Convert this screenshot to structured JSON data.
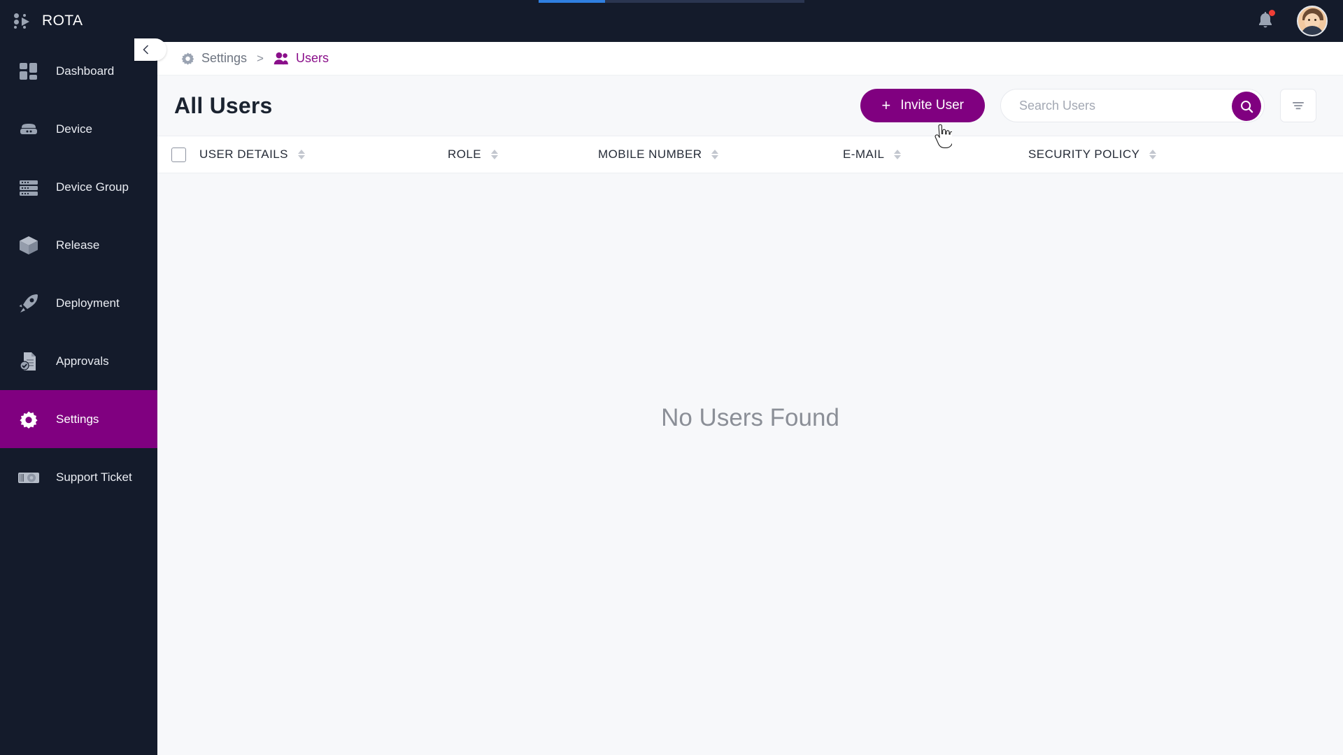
{
  "app": {
    "brand_name": "ROTA",
    "logo_icon": "rota-dots-logo"
  },
  "topbar": {
    "notification_icon": "bell-icon",
    "notification_badge": "",
    "avatar_icon": "user-avatar",
    "progress_icon": "loading-progress-bar"
  },
  "sidebar": {
    "collapse_icon": "chevron-left-icon",
    "items": [
      {
        "label": "Dashboard",
        "icon": "dashboard-grid-icon",
        "active": false
      },
      {
        "label": "Device",
        "icon": "device-server-icon",
        "active": false
      },
      {
        "label": "Device Group",
        "icon": "device-group-icon",
        "active": false
      },
      {
        "label": "Release",
        "icon": "release-box-icon",
        "active": false
      },
      {
        "label": "Deployment",
        "icon": "rocket-icon",
        "active": false
      },
      {
        "label": "Approvals",
        "icon": "document-check-icon",
        "active": false
      },
      {
        "label": "Settings",
        "icon": "gear-icon",
        "active": true
      },
      {
        "label": "Support Ticket",
        "icon": "support-ticket-icon",
        "active": false
      }
    ]
  },
  "breadcrumb": {
    "items": [
      {
        "label": "Settings",
        "icon": "gear-icon",
        "current": false
      },
      {
        "label": "Users",
        "icon": "users-icon",
        "current": true
      }
    ],
    "separator": ">"
  },
  "page": {
    "title": "All Users",
    "invite_button": {
      "label": "Invite User",
      "icon": "plus-icon"
    },
    "search": {
      "placeholder": "Search Users",
      "value": "",
      "icon": "search-icon"
    },
    "filter_button": {
      "icon": "filter-icon"
    }
  },
  "table": {
    "select_all_icon": "checkbox-unchecked",
    "columns": [
      {
        "label": "USER DETAILS",
        "sortable": true
      },
      {
        "label": "ROLE",
        "sortable": true
      },
      {
        "label": "MOBILE NUMBER",
        "sortable": true
      },
      {
        "label": "E-MAIL",
        "sortable": true
      },
      {
        "label": "SECURITY POLICY",
        "sortable": true
      }
    ],
    "rows": [],
    "empty_message": "No Users Found"
  },
  "colors": {
    "accent_purple": "#800080",
    "sidebar_dark": "#141b2b",
    "page_bg": "#f7f8fa",
    "badge_red": "#ef3e36"
  }
}
